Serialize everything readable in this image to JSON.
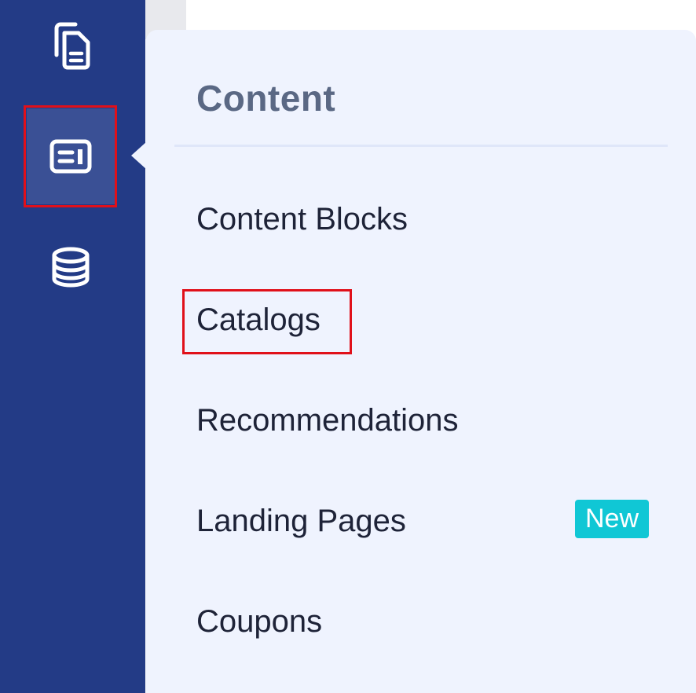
{
  "sidebar": {
    "icons": [
      {
        "name": "pages-icon"
      },
      {
        "name": "content-icon"
      },
      {
        "name": "database-icon"
      }
    ]
  },
  "flyout": {
    "title": "Content",
    "items": [
      {
        "label": "Content Blocks"
      },
      {
        "label": "Catalogs"
      },
      {
        "label": "Recommendations"
      },
      {
        "label": "Landing Pages",
        "badge": "New"
      },
      {
        "label": "Coupons"
      }
    ]
  },
  "colors": {
    "sidebar_bg": "#233b86",
    "flyout_bg": "#eff3fe",
    "badge_bg": "#10c7d5",
    "highlight": "#e0101a"
  }
}
